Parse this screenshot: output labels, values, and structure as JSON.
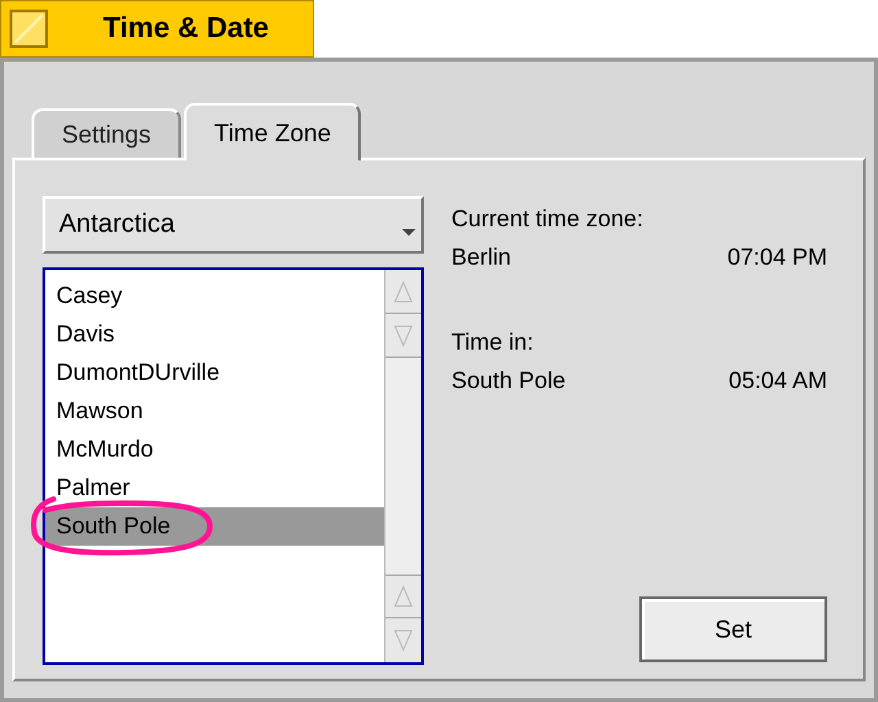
{
  "window": {
    "title": "Time & Date"
  },
  "tabs": [
    {
      "label": "Settings",
      "selected": false
    },
    {
      "label": "Time Zone",
      "selected": true
    }
  ],
  "region_menu": {
    "value": "Antarctica"
  },
  "city_list": {
    "items": [
      {
        "label": "Casey",
        "selected": false
      },
      {
        "label": "Davis",
        "selected": false
      },
      {
        "label": "DumontDUrville",
        "selected": false
      },
      {
        "label": "Mawson",
        "selected": false
      },
      {
        "label": "McMurdo",
        "selected": false
      },
      {
        "label": "Palmer",
        "selected": false
      },
      {
        "label": "South Pole",
        "selected": true
      }
    ]
  },
  "current": {
    "heading": "Current time zone:",
    "city": "Berlin",
    "time": "07:04 PM"
  },
  "other": {
    "heading": "Time in:",
    "city": "South Pole",
    "time": "05:04 AM"
  },
  "buttons": [
    {
      "label": "Set"
    }
  ]
}
